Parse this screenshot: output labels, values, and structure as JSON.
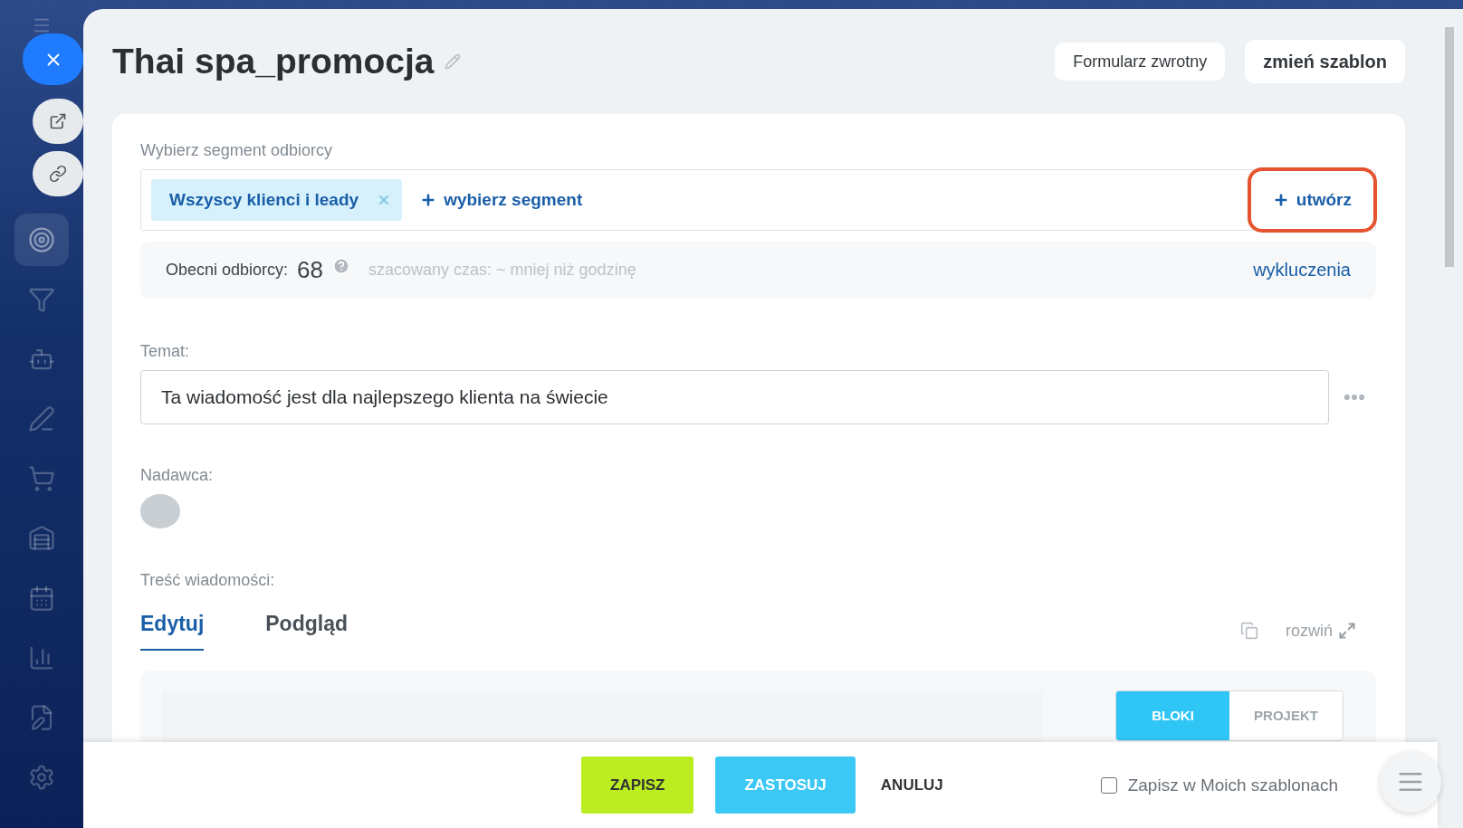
{
  "sidebar": {
    "items": [
      {
        "selected": false
      },
      {
        "selected": false
      },
      {
        "selected": false
      },
      {
        "selected": true
      },
      {
        "selected": false
      },
      {
        "selected": false
      },
      {
        "selected": false
      },
      {
        "selected": false
      },
      {
        "selected": false
      },
      {
        "selected": false
      },
      {
        "selected": false
      },
      {
        "selected": false
      },
      {
        "selected": false
      }
    ]
  },
  "header": {
    "title": "Thai spa_promocja",
    "buttons": [
      {
        "label": "Formularz zwrotny",
        "kind": "light"
      },
      {
        "label": "zmień szablon",
        "kind": "bold"
      }
    ]
  },
  "segment": {
    "label": "Wybierz segment odbiorcy",
    "tags": [
      {
        "label": "Wszyscy klienci i leady"
      }
    ],
    "select_link": "wybierz segment",
    "create_link": {
      "label": "utwórz",
      "highlighted": true
    }
  },
  "recipients": {
    "label": "Obecni odbiorcy:",
    "count": "68",
    "estimate": "szacowany czas: ~ mniej niż godzinę",
    "exclusions_link": "wykluczenia"
  },
  "subject": {
    "label": "Temat:",
    "value": "Ta wiadomość jest dla najlepszego klienta na świecie"
  },
  "sender": {
    "label": "Nadawca:"
  },
  "content": {
    "label": "Treść wiadomości:",
    "tabs": [
      {
        "label": "Edytuj",
        "selected": true
      },
      {
        "label": "Podgląd",
        "selected": false
      }
    ],
    "expand_link": "rozwiń",
    "modes": [
      {
        "label": "BLOKI",
        "selected": true
      },
      {
        "label": "PROJEKT",
        "selected": false
      }
    ]
  },
  "footer": {
    "buttons": [
      {
        "label": "ZAPISZ",
        "kind": "save"
      },
      {
        "label": "ZASTOSUJ",
        "kind": "apply"
      },
      {
        "label": "ANULUJ",
        "kind": "cancel"
      }
    ],
    "save_template": {
      "label": "Zapisz w Moich szablonach",
      "checked": false
    }
  }
}
